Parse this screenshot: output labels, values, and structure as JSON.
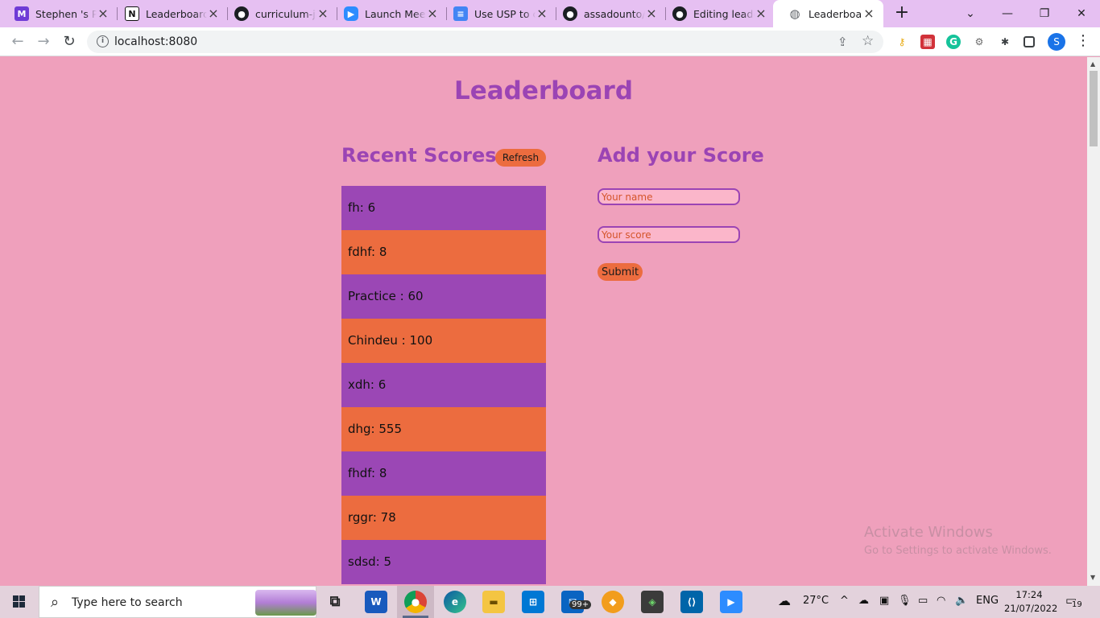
{
  "browser": {
    "tabs": [
      {
        "label": "Stephen 's Pr",
        "icon": "tab-favicon-purple-m",
        "color": "#6f3bd6",
        "glyph": "M"
      },
      {
        "label": "Leaderboard",
        "icon": "notion-icon",
        "color": "#202124",
        "glyph": "N"
      },
      {
        "label": "curriculum-ja",
        "icon": "github-icon",
        "color": "#202124",
        "glyph": "●"
      },
      {
        "label": "Launch Meeti",
        "icon": "zoom-icon",
        "color": "#2d8cff",
        "glyph": "▶"
      },
      {
        "label": "Use USP to cr",
        "icon": "google-docs-icon",
        "color": "#4285f4",
        "glyph": "≡"
      },
      {
        "label": "assadounto/L",
        "icon": "github-icon",
        "color": "#202124",
        "glyph": "●"
      },
      {
        "label": "Editing leade",
        "icon": "github-icon",
        "color": "#202124",
        "glyph": "●"
      },
      {
        "label": "Leaderboard",
        "icon": "globe-icon",
        "color": "#5f6368",
        "glyph": "◍"
      }
    ],
    "new_tab": "+",
    "window_controls": {
      "tab_search": "⌄",
      "minimize": "—",
      "restore": "❐",
      "close": "✕"
    },
    "address": "localhost:8080",
    "profile_initial": "S"
  },
  "page": {
    "title": "Leaderboard",
    "recent_scores_title": "Recent Scores",
    "refresh_label": "Refresh",
    "add_score_title": "Add your Score",
    "name_placeholder": "Your name",
    "score_placeholder": "Your score",
    "submit_label": "Submit",
    "scores": [
      "fh: 6",
      "fdhf: 8",
      "Practice : 60",
      "Chindeu : 100",
      "xdh: 6",
      "dhg: 555",
      "fhdf: 8",
      "rggr: 78",
      "sdsd: 5"
    ],
    "colors": {
      "background": "#efa0bc",
      "accent_purple": "#9b44b4",
      "accent_orange": "#ec6c3f"
    }
  },
  "watermark": {
    "line1": "Activate Windows",
    "line2": "Go to Settings to activate Windows."
  },
  "taskbar": {
    "search_placeholder": "Type here to search",
    "mail_badge": "99+",
    "weather": "27°C",
    "language": "ENG",
    "time": "17:24",
    "date": "21/07/2022",
    "notifications": "19"
  }
}
